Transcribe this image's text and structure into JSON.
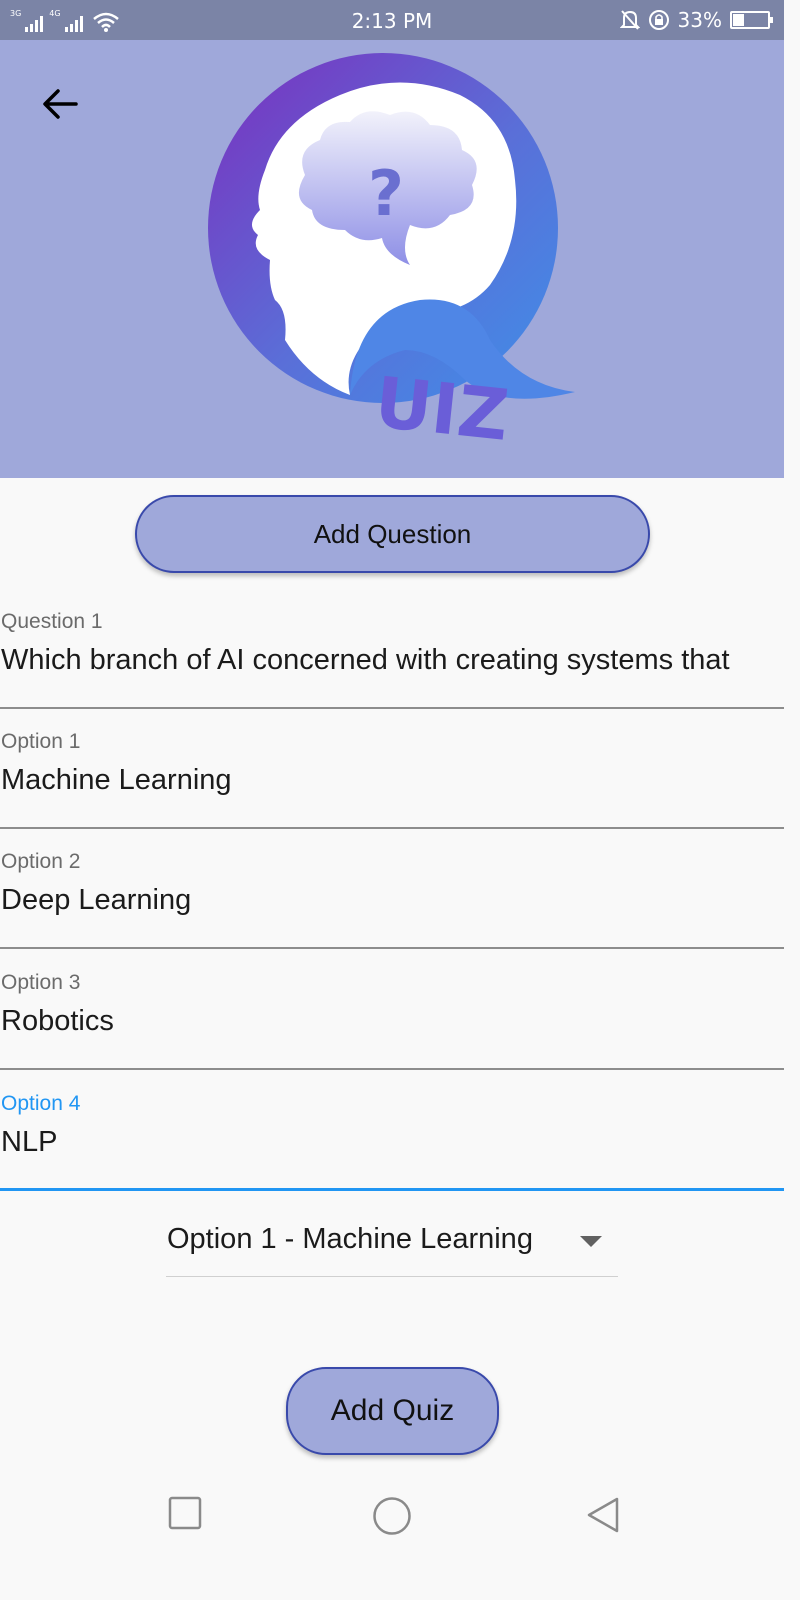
{
  "status_bar": {
    "network_1": "3G",
    "network_2": "4G",
    "time": "2:13 PM",
    "battery_percent": "33%",
    "battery_level": 0.33,
    "icons": [
      "signal-icon",
      "wifi-icon",
      "bell-off-icon",
      "rotation-lock-icon",
      "battery-icon"
    ]
  },
  "header": {
    "background_color": "#9fa8da",
    "back_icon": "arrow-left-icon",
    "logo_text": "UIZ",
    "logo_glyph": "?"
  },
  "add_question_button": {
    "label": "Add Question"
  },
  "question": {
    "label": "Question 1",
    "value": "Which branch of AI concerned with creating systems that"
  },
  "options": [
    {
      "label": "Option 1",
      "value": "Machine Learning"
    },
    {
      "label": "Option 2",
      "value": "Deep Learning"
    },
    {
      "label": "Option 3",
      "value": "Robotics"
    },
    {
      "label": "Option 4",
      "value": "NLP"
    }
  ],
  "answer_dropdown": {
    "selected": "Option 1 - Machine Learning"
  },
  "add_quiz_button": {
    "label": "Add Quiz"
  },
  "navbar": {
    "icons": [
      "recent-apps-icon",
      "home-icon",
      "back-triangle-icon"
    ]
  },
  "colors": {
    "accent": "#2196f3",
    "button_border": "#3949ab",
    "button_fill": "#9fa8da",
    "status_bar": "#7b84a6"
  }
}
